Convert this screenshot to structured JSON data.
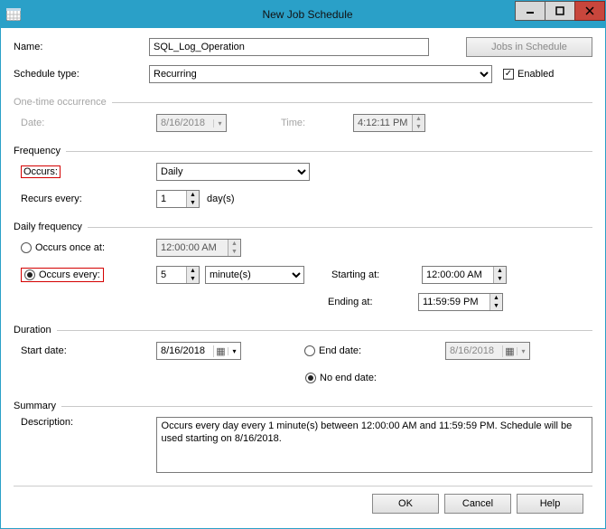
{
  "window": {
    "title": "New Job Schedule"
  },
  "topbar": {
    "name_label": "Name:",
    "name_value": "SQL_Log_Operation",
    "jobs_btn": "Jobs in Schedule",
    "schedule_type_label": "Schedule type:",
    "schedule_type_value": "Recurring",
    "enabled_label": "Enabled"
  },
  "onetime": {
    "group": "One-time occurrence",
    "date_label": "Date:",
    "date_value": "8/16/2018",
    "time_label": "Time:",
    "time_value": "4:12:11 PM"
  },
  "frequency": {
    "group": "Frequency",
    "occurs_label": "Occurs:",
    "occurs_value": "Daily",
    "recurs_label": "Recurs every:",
    "recurs_value": "1",
    "recurs_unit": "day(s)"
  },
  "daily": {
    "group": "Daily frequency",
    "once_label": "Occurs once at:",
    "once_value": "12:00:00 AM",
    "every_label": "Occurs every:",
    "every_value": "5",
    "every_unit": "minute(s)",
    "start_label": "Starting at:",
    "start_value": "12:00:00 AM",
    "end_label": "Ending at:",
    "end_value": "11:59:59 PM"
  },
  "duration": {
    "group": "Duration",
    "start_label": "Start date:",
    "start_value": "8/16/2018",
    "enddate_label": "End date:",
    "enddate_value": "8/16/2018",
    "noend_label": "No end date:"
  },
  "summary": {
    "group": "Summary",
    "desc_label": "Description:",
    "desc_value": "Occurs every day every 1 minute(s) between 12:00:00 AM and 11:59:59 PM. Schedule will be used starting on 8/16/2018."
  },
  "buttons": {
    "ok": "OK",
    "cancel": "Cancel",
    "help": "Help"
  }
}
